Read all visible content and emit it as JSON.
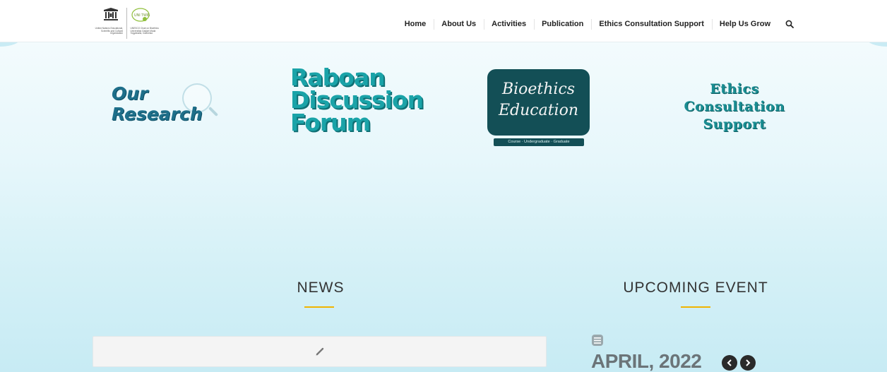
{
  "header": {
    "logo": {
      "unesco_text": "United Nations Educational, Scientific and Cultural Organization",
      "chair_text": "UNESCO Chair on Bioethics Universitas Gadjah Mada Yogyakarta, Indonesia"
    },
    "nav": [
      {
        "label": "Home"
      },
      {
        "label": "About Us"
      },
      {
        "label": "Activities"
      },
      {
        "label": "Publication"
      },
      {
        "label": "Ethics Consultation Support"
      },
      {
        "label": "Help Us Grow"
      }
    ],
    "search_icon": "search-icon"
  },
  "features": {
    "research": {
      "line1": "Our",
      "line2": "Research"
    },
    "raboan": {
      "line1": "Raboan",
      "line2": "Discussion",
      "line3": "Forum"
    },
    "bioethics": {
      "line1": "Bioethics",
      "line2": "Education",
      "sub": "Course · Undergraduate · Graduate"
    },
    "ethics": {
      "line1": "Ethics",
      "line2": "Consultation",
      "line3": "Support"
    }
  },
  "sections": {
    "news_title": "NEWS",
    "event_title": "UPCOMING EVENT",
    "event_month": "APRIL, 2022"
  },
  "colors": {
    "accent_rule": "#f0b400",
    "teal": "#1aa3a8",
    "dark_teal": "#134f56"
  }
}
